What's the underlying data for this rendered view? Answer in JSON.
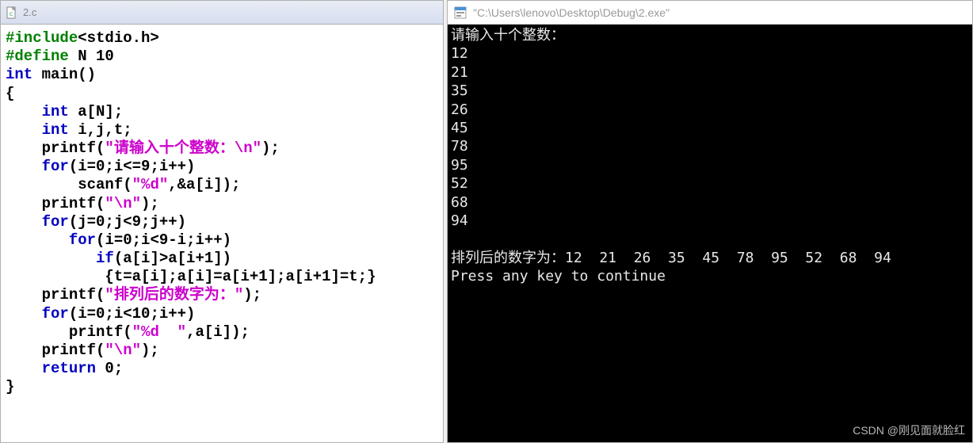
{
  "editor": {
    "filename": "2.c",
    "code_html": "<span class='pp'>#include</span><span class='hd'>&lt;stdio.h&gt;</span>\n<span class='pp'>#define</span> N 10\n<span class='kw'>int</span> main()\n{\n    <span class='kw'>int</span> a[N];\n    <span class='kw'>int</span> i,j,t;\n    printf(<span class='str'>\"请输入十个整数：\\n\"</span>);\n    <span class='kw'>for</span>(i=0;i&lt;=9;i++)\n        scanf(<span class='str'>\"%d\"</span>,&amp;a[i]);\n    printf(<span class='str'>\"\\n\"</span>);\n    <span class='kw'>for</span>(j=0;j&lt;9;j++)\n       <span class='kw'>for</span>(i=0;i&lt;9-i;i++)\n          <span class='kw'>if</span>(a[i]&gt;a[i+1])\n           {t=a[i];a[i]=a[i+1];a[i+1]=t;}\n    printf(<span class='str'>\"排列后的数字为：\"</span>);\n    <span class='kw'>for</span>(i=0;i&lt;10;i++)\n       printf(<span class='str'>\"%d  \"</span>,a[i]);\n    printf(<span class='str'>\"\\n\"</span>);\n    <span class='kw'>return</span> 0;\n}"
  },
  "console": {
    "title": "\"C:\\Users\\lenovo\\Desktop\\Debug\\2.exe\"",
    "prompt": "请输入十个整数：",
    "inputs": [
      "12",
      "21",
      "35",
      "26",
      "45",
      "78",
      "95",
      "52",
      "68",
      "94"
    ],
    "result_label": "排列后的数字为：",
    "result_values": [
      "12",
      "21",
      "26",
      "35",
      "45",
      "78",
      "95",
      "52",
      "68",
      "94"
    ],
    "continue": "Press any key to continue"
  },
  "watermark": "CSDN @刚见面就脸红"
}
